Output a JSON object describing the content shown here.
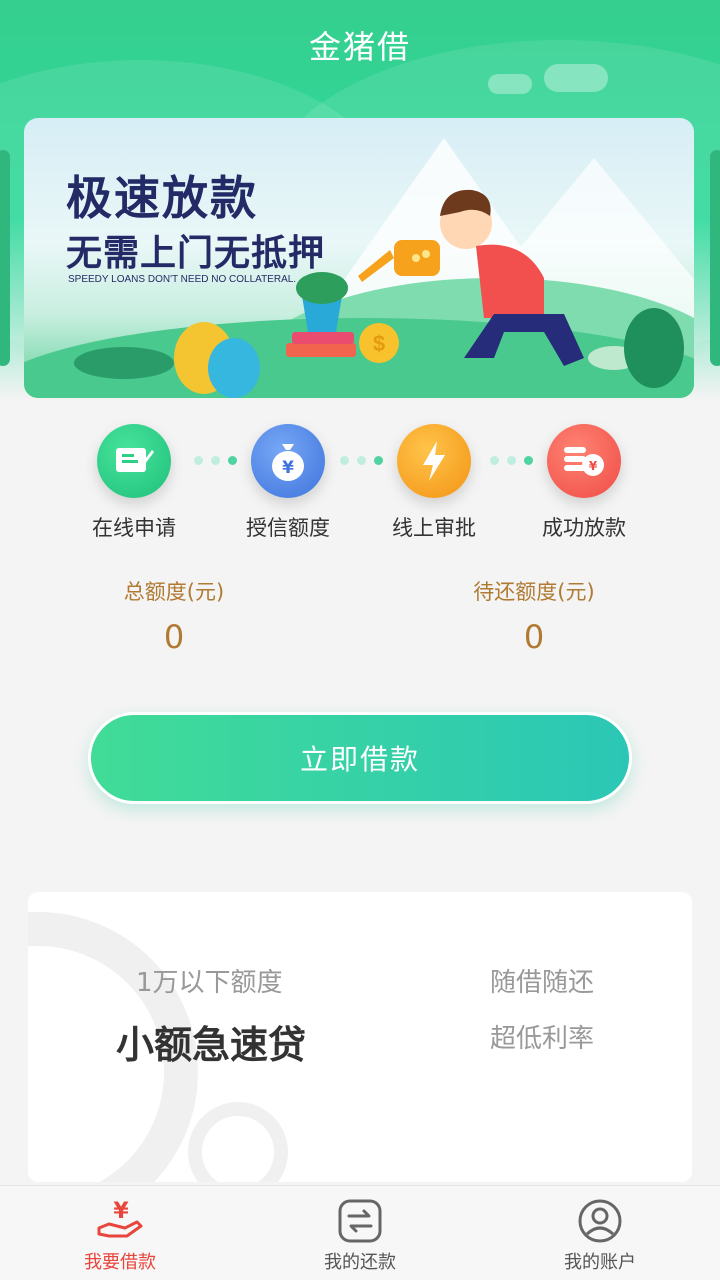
{
  "app": {
    "title": "金猪借"
  },
  "banner": {
    "headline": "极速放款",
    "subheadline": "无需上门无抵押",
    "caption": "SPEEDY LOANS DON'T NEED NO COLLATERAL."
  },
  "steps": [
    {
      "label": "在线申请",
      "icon": "form-icon",
      "color": "#2ecf86"
    },
    {
      "label": "授信额度",
      "icon": "money-bag-icon",
      "color": "#4f86e8"
    },
    {
      "label": "线上审批",
      "icon": "lightning-icon",
      "color": "#f7a21c"
    },
    {
      "label": "成功放款",
      "icon": "coins-icon",
      "color": "#f5584f"
    }
  ],
  "amounts": {
    "total_label": "总额度(元)",
    "total_value": "0",
    "pending_label": "待还额度(元)",
    "pending_value": "0"
  },
  "borrow_button": {
    "label": "立即借款"
  },
  "promo": {
    "limit_text": "1万以下额度",
    "product_name": "小额急速贷",
    "feature_1": "随借随还",
    "feature_2": "超低利率"
  },
  "tabbar": {
    "tabs": [
      {
        "label": "我要借款",
        "icon": "borrow-hand-icon",
        "active": true
      },
      {
        "label": "我的还款",
        "icon": "repay-exchange-icon",
        "active": false
      },
      {
        "label": "我的账户",
        "icon": "account-user-icon",
        "active": false
      }
    ],
    "active_color": "#e8453c"
  }
}
